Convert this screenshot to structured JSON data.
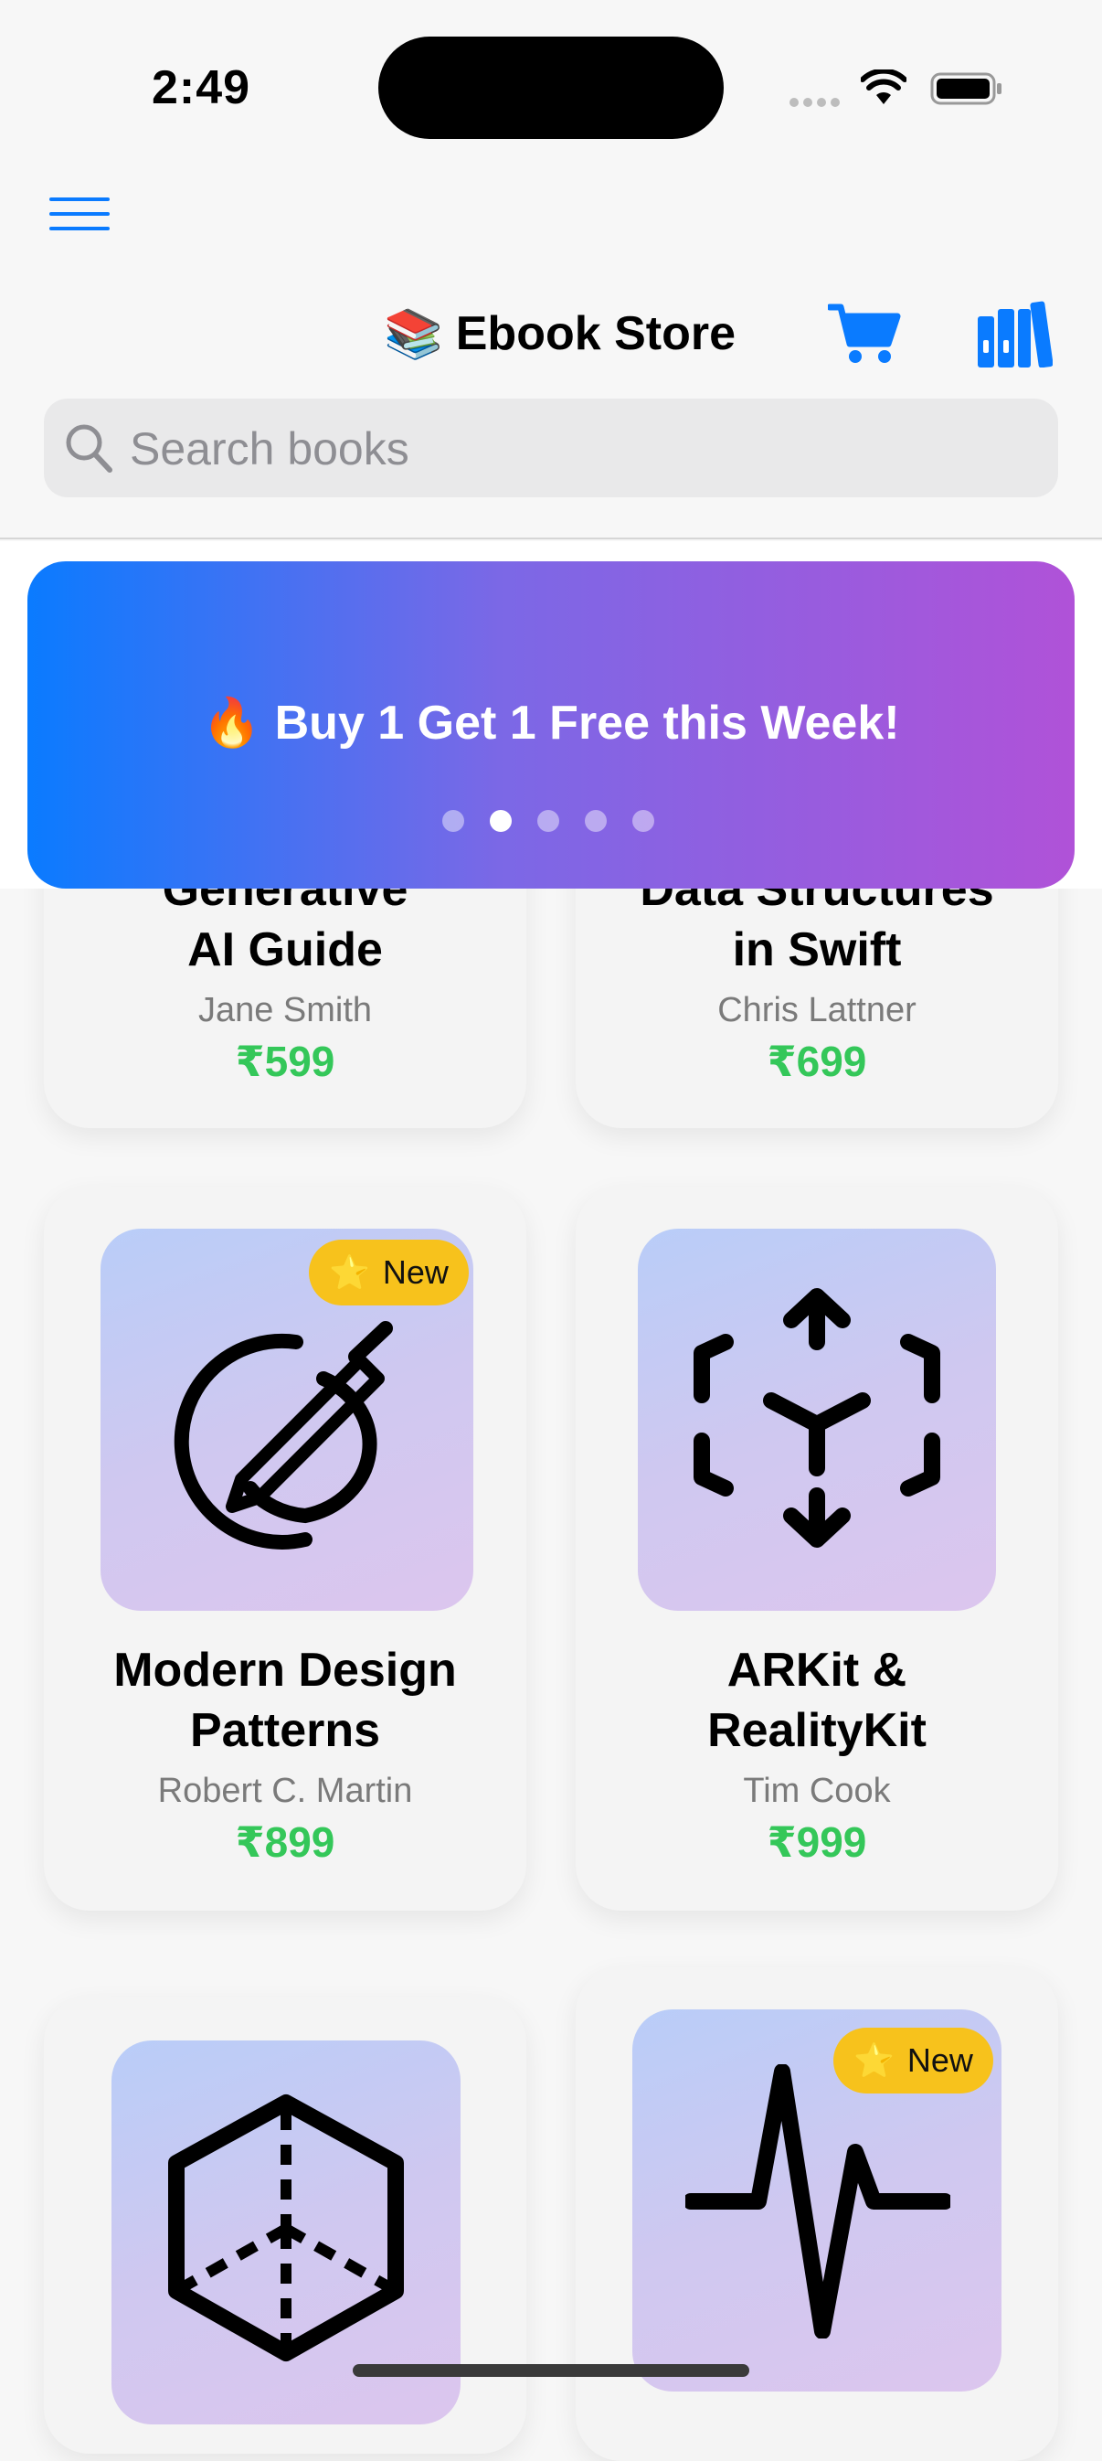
{
  "status": {
    "time": "2:49"
  },
  "header": {
    "title_emoji": "📚",
    "title": "Ebook Store"
  },
  "search": {
    "placeholder": "Search books",
    "value": ""
  },
  "banner": {
    "emoji": "🔥",
    "text": "Buy 1 Get 1 Free this Week!",
    "page_count": 5,
    "active_index": 1
  },
  "books": [
    {
      "title_line1": "Generative",
      "title_line2": "AI Guide",
      "author": "Jane Smith",
      "price": "₹599"
    },
    {
      "title_line1": "Data Structures",
      "title_line2": "in Swift",
      "author": "Chris Lattner",
      "price": "₹699"
    },
    {
      "title_line1": "Modern Design",
      "title_line2": "Patterns",
      "author": "Robert C. Martin",
      "price": "₹899",
      "badge": "New",
      "icon": "pencil-circle-icon"
    },
    {
      "title_line1": "ARKit &",
      "title_line2": "RealityKit",
      "author": "Tim Cook",
      "price": "₹999",
      "icon": "ar-arrows-cube-icon"
    },
    {
      "icon": "cube-icon"
    },
    {
      "badge": "New",
      "icon": "waveform-icon"
    }
  ],
  "colors": {
    "accent": "#0a7bff",
    "price": "#34c759",
    "badge": "#f7c21c"
  }
}
